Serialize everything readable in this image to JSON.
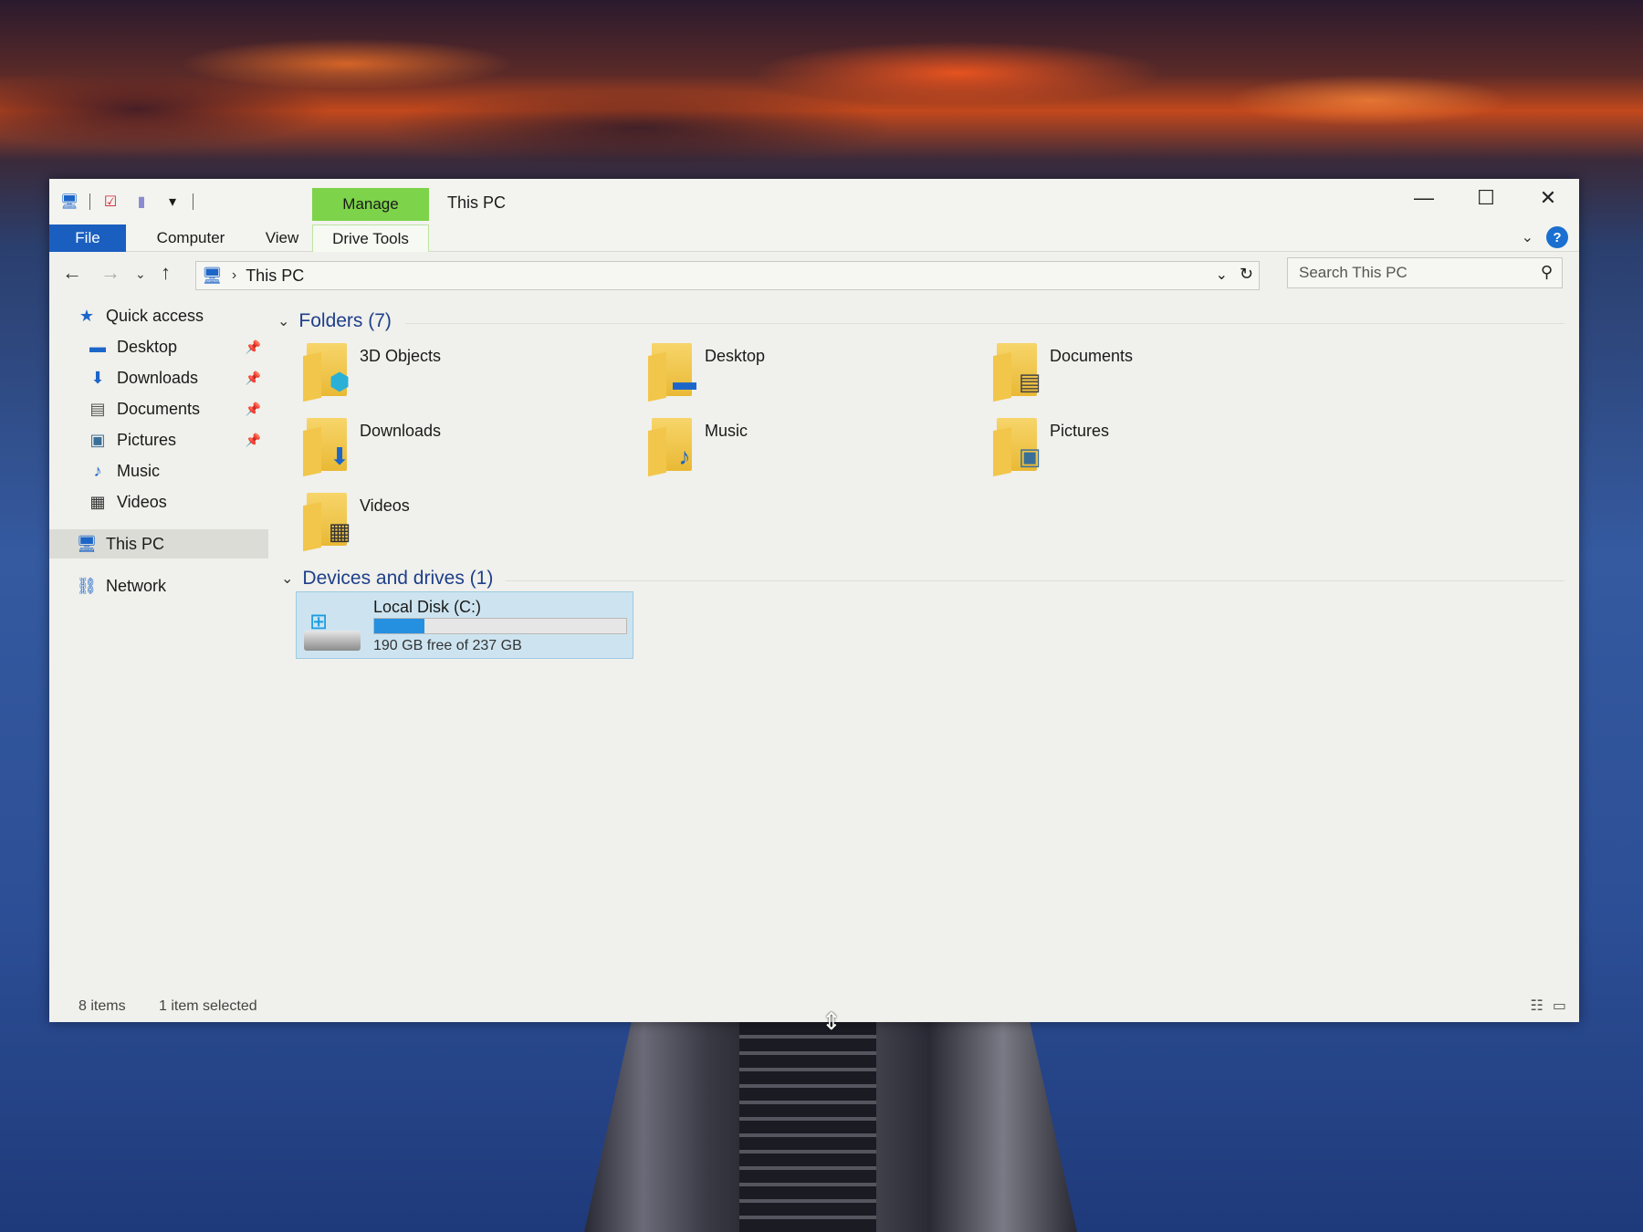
{
  "window": {
    "title": "This PC",
    "manage_tab": "Manage",
    "controls": {
      "minimize": "—",
      "maximize": "☐",
      "close": "✕"
    }
  },
  "qat": {
    "icons": [
      "computer-icon",
      "properties-icon",
      "new-folder-icon",
      "customize-dropdown-icon"
    ]
  },
  "ribbon": {
    "tabs": [
      {
        "label": "File"
      },
      {
        "label": "Computer"
      },
      {
        "label": "View"
      },
      {
        "label": "Drive Tools"
      }
    ]
  },
  "navigation": {
    "address_path": "This PC",
    "search_placeholder": "Search This PC"
  },
  "sidebar": {
    "items": [
      {
        "label": "Quick access",
        "icon": "star-icon"
      },
      {
        "label": "Desktop",
        "icon": "desktop-icon",
        "pinned": true
      },
      {
        "label": "Downloads",
        "icon": "download-arrow-icon",
        "pinned": true
      },
      {
        "label": "Documents",
        "icon": "document-icon",
        "pinned": true
      },
      {
        "label": "Pictures",
        "icon": "picture-icon",
        "pinned": true
      },
      {
        "label": "Music",
        "icon": "music-note-icon"
      },
      {
        "label": "Videos",
        "icon": "film-icon"
      },
      {
        "label": "This PC",
        "icon": "computer-icon",
        "selected": true
      },
      {
        "label": "Network",
        "icon": "network-icon"
      }
    ]
  },
  "content": {
    "folders_header": "Folders (7)",
    "folders": [
      {
        "name": "3D Objects",
        "icon": "cube-icon"
      },
      {
        "name": "Desktop",
        "icon": "desktop-icon"
      },
      {
        "name": "Documents",
        "icon": "document-icon"
      },
      {
        "name": "Downloads",
        "icon": "download-arrow-icon"
      },
      {
        "name": "Music",
        "icon": "music-note-icon"
      },
      {
        "name": "Pictures",
        "icon": "picture-icon"
      },
      {
        "name": "Videos",
        "icon": "film-icon"
      }
    ],
    "devices_header": "Devices and drives (1)",
    "drive": {
      "name": "Local Disk (C:)",
      "free_text": "190 GB free of 237 GB",
      "used_fraction": 0.2
    }
  },
  "status": {
    "items": "8 items",
    "selected": "1 item selected"
  },
  "colors": {
    "file_tab": "#1a5fbf",
    "manage_tab": "#7dd34a",
    "header_text": "#1e3f8a",
    "drive_fill": "#2690e0",
    "selection": "#cde4f0"
  }
}
